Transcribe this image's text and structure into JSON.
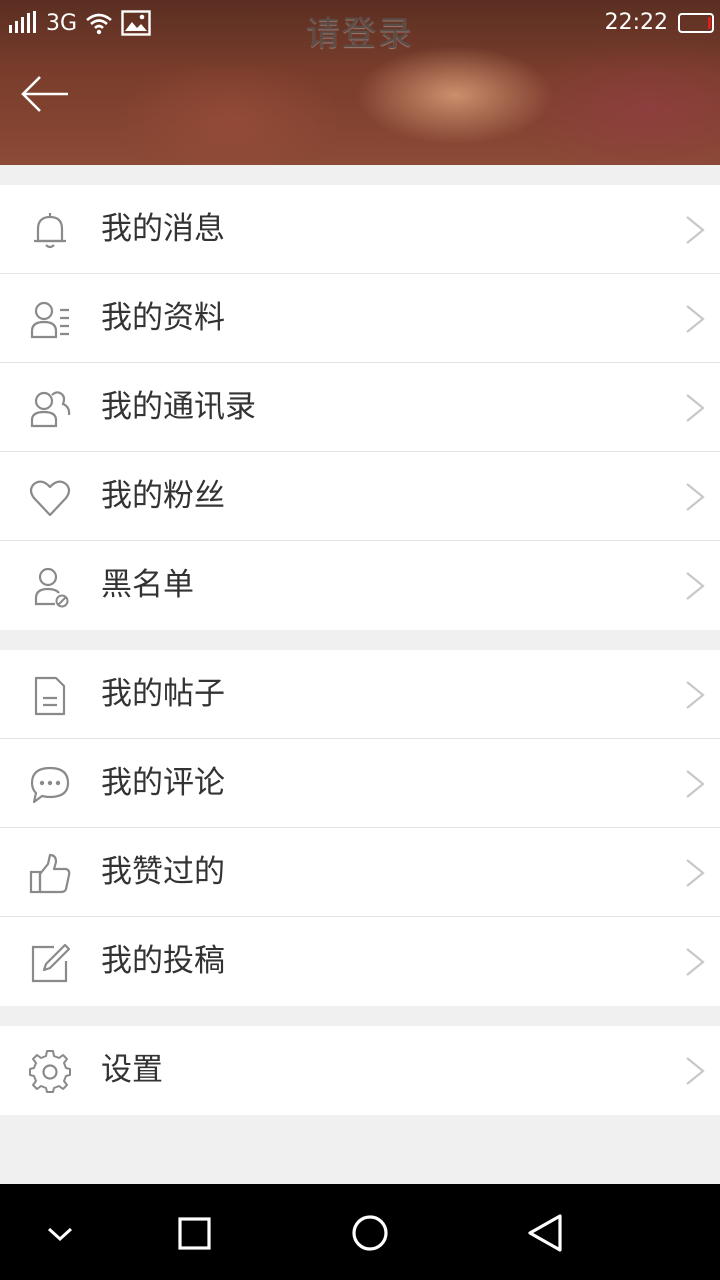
{
  "status_bar": {
    "network": "3G",
    "title": "请登录",
    "time": "22:22"
  },
  "menu_groups": [
    {
      "items": [
        {
          "label": "我的消息",
          "icon": "bell-icon"
        },
        {
          "label": "我的资料",
          "icon": "profile-card-icon"
        },
        {
          "label": "我的通讯录",
          "icon": "contacts-icon"
        },
        {
          "label": "我的粉丝",
          "icon": "heart-icon"
        },
        {
          "label": "黑名单",
          "icon": "blocked-user-icon"
        }
      ]
    },
    {
      "items": [
        {
          "label": "我的帖子",
          "icon": "document-icon"
        },
        {
          "label": "我的评论",
          "icon": "comment-icon"
        },
        {
          "label": "我赞过的",
          "icon": "thumbs-up-icon"
        },
        {
          "label": "我的投稿",
          "icon": "edit-icon"
        }
      ]
    },
    {
      "items": [
        {
          "label": "设置",
          "icon": "gear-icon"
        }
      ]
    }
  ],
  "colors": {
    "icon_stroke": "#8a8a8a",
    "chevron": "#c8c8c8",
    "battery_low": "#e0201a"
  }
}
